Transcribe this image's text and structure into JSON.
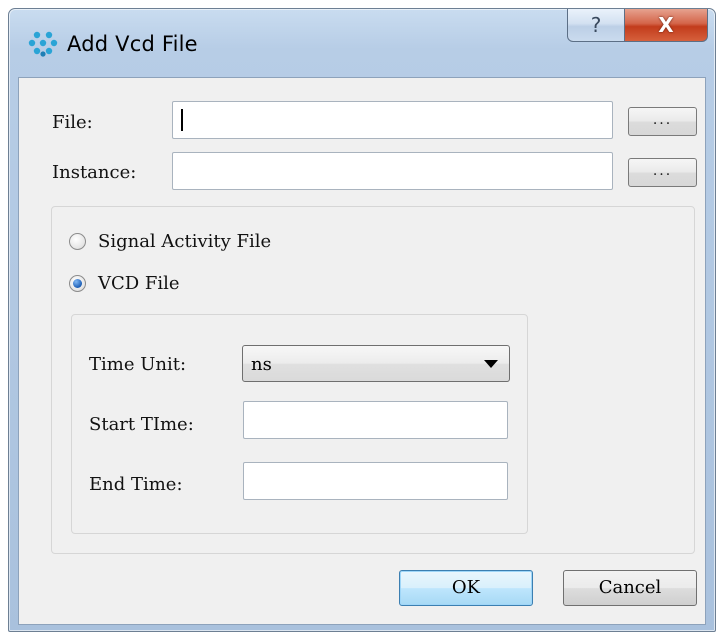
{
  "window": {
    "title": "Add Vcd File",
    "help_label": "?",
    "close_label": "X"
  },
  "file": {
    "label": "File:",
    "value": "",
    "browse_label": "..."
  },
  "instance": {
    "label": "Instance:",
    "value": "",
    "browse_label": "..."
  },
  "file_type": {
    "options": [
      {
        "label": "Signal Activity File",
        "checked": false
      },
      {
        "label": "VCD File",
        "checked": true
      }
    ]
  },
  "vcd": {
    "time_unit_label": "Time Unit:",
    "time_unit_value": "ns",
    "start_time_label": "Start TIme:",
    "start_time_value": "",
    "end_time_label": "End Time:",
    "end_time_value": ""
  },
  "buttons": {
    "ok": "OK",
    "cancel": "Cancel"
  },
  "colors": {
    "titlebar": "#b7cde6",
    "client_bg": "#f0f0f0",
    "close_button": "#c23c1c",
    "ok_button_border": "#3c7fb1",
    "radio_selected": "#1d5fb6"
  }
}
